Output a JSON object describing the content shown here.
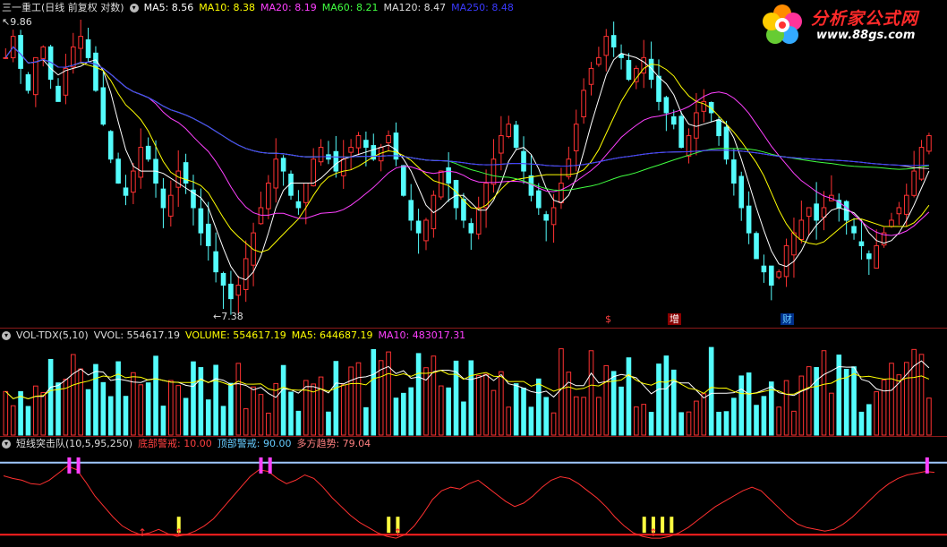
{
  "price_header": {
    "title": "三一重工(日线 前复权 对数)",
    "ma": [
      {
        "label": "MA5: 8.56",
        "color": "#ffffff"
      },
      {
        "label": "MA10: 8.38",
        "color": "#ffff00"
      },
      {
        "label": "MA20: 8.19",
        "color": "#ff40ff"
      },
      {
        "label": "MA60: 8.21",
        "color": "#40ff40"
      },
      {
        "label": "MA120: 8.47",
        "color": "#dddddd"
      },
      {
        "label": "MA250: 8.48",
        "color": "#3a3aff"
      }
    ]
  },
  "price_marks": {
    "high": "9.86",
    "low": "←7.38"
  },
  "event_labels": [
    {
      "text": "$",
      "color": "#ff4040"
    },
    {
      "text": "增",
      "color": "#ffffff",
      "bg": "#8b0000"
    },
    {
      "text": "财",
      "color": "#66ccff",
      "bg": "#00308b"
    }
  ],
  "logo": {
    "title": "分析家公式网",
    "url": "www.88gs.com"
  },
  "vol_header": {
    "title": "VOL-TDX(5,10)",
    "items": [
      {
        "label": "VVOL: 554617.19",
        "color": "#dddddd"
      },
      {
        "label": "VOLUME: 554617.19",
        "color": "#ffff00"
      },
      {
        "label": "MA5: 644687.19",
        "color": "#ffff00"
      },
      {
        "label": "MA10: 483017.31",
        "color": "#ff40ff"
      }
    ]
  },
  "ind_header": {
    "title": "短线突击队(10,5,95,250)",
    "items": [
      {
        "label": "底部警戒: 10.00",
        "color": "#ff4040"
      },
      {
        "label": "顶部警戒: 90.00",
        "color": "#66ccff"
      },
      {
        "label": "多方趋势: 79.04",
        "color": "#ff8080"
      }
    ]
  },
  "chart_data": [
    {
      "type": "candlestick",
      "title": "三一重工(日线 前复权 对数)",
      "ylim": [
        7.38,
        9.86
      ],
      "log_scale": true,
      "series": [
        {
          "name": "MA5",
          "values": [
            8.56
          ]
        },
        {
          "name": "MA10",
          "values": [
            8.38
          ]
        },
        {
          "name": "MA20",
          "values": [
            8.19
          ]
        },
        {
          "name": "MA60",
          "values": [
            8.21
          ]
        },
        {
          "name": "MA120",
          "values": [
            8.47
          ]
        },
        {
          "name": "MA250",
          "values": [
            8.48
          ]
        }
      ],
      "close_trend": [
        9.5,
        9.7,
        9.4,
        9.2,
        9.5,
        9.6,
        9.3,
        9.1,
        9.4,
        9.6,
        9.7,
        9.5,
        9.2,
        8.9,
        8.6,
        8.4,
        8.3,
        8.5,
        8.7,
        8.6,
        8.4,
        8.2,
        8.3,
        8.5,
        8.4,
        8.2,
        8.0,
        7.9,
        7.7,
        7.6,
        7.5,
        7.6,
        7.8,
        8.0,
        8.2,
        8.4,
        8.6,
        8.5,
        8.3,
        8.2,
        8.4,
        8.6,
        8.7,
        8.6,
        8.5,
        8.6,
        8.7,
        8.8,
        8.7,
        8.6,
        8.7,
        8.8,
        8.6,
        8.3,
        8.1,
        8.0,
        8.1,
        8.3,
        8.5,
        8.4,
        8.2,
        8.1,
        8.0,
        8.2,
        8.4,
        8.6,
        8.8,
        8.9,
        8.7,
        8.5,
        8.3,
        8.2,
        8.1,
        8.2,
        8.4,
        8.6,
        8.9,
        9.2,
        9.4,
        9.5,
        9.7,
        9.6,
        9.5,
        9.3,
        9.4,
        9.5,
        9.3,
        9.1,
        9.0,
        8.9,
        8.7,
        8.8,
        9.0,
        9.1,
        9.0,
        8.8,
        8.6,
        8.4,
        8.2,
        8.0,
        7.8,
        7.7,
        7.6,
        7.7,
        7.9,
        8.0,
        8.1,
        8.2,
        8.1,
        8.2,
        8.3,
        8.2,
        8.1,
        8.0,
        7.9,
        7.8,
        7.9,
        8.0,
        8.1,
        8.2,
        8.3,
        8.5,
        8.7,
        8.8
      ]
    },
    {
      "type": "bar",
      "title": "VOL-TDX(5,10)",
      "series": [
        {
          "name": "VOLUME",
          "values": [
            554617.19
          ]
        },
        {
          "name": "MA5",
          "values": [
            644687.19
          ]
        },
        {
          "name": "MA10",
          "values": [
            483017.31
          ]
        }
      ]
    },
    {
      "type": "line",
      "title": "短线突击队(10,5,95,250)",
      "ylim": [
        0,
        100
      ],
      "series": [
        {
          "name": "底部警戒",
          "values": [
            10.0
          ]
        },
        {
          "name": "顶部警戒",
          "values": [
            90.0
          ]
        },
        {
          "name": "多方趋势",
          "values": [
            79.04
          ]
        }
      ],
      "trend_shape": [
        75,
        72,
        70,
        66,
        65,
        70,
        78,
        86,
        82,
        68,
        52,
        40,
        28,
        18,
        12,
        8,
        10,
        14,
        9,
        6,
        8,
        12,
        18,
        26,
        38,
        50,
        62,
        74,
        82,
        80,
        72,
        66,
        70,
        76,
        72,
        62,
        50,
        40,
        30,
        22,
        16,
        10,
        6,
        4,
        8,
        18,
        32,
        48,
        58,
        62,
        60,
        66,
        70,
        62,
        54,
        46,
        40,
        44,
        52,
        62,
        70,
        74,
        72,
        66,
        58,
        50,
        40,
        28,
        18,
        10,
        6,
        4,
        4,
        6,
        10,
        16,
        24,
        32,
        40,
        46,
        52,
        58,
        62,
        58,
        48,
        38,
        28,
        20,
        16,
        14,
        12,
        14,
        20,
        28,
        38,
        48,
        58,
        66,
        72,
        76,
        78,
        80,
        79
      ]
    }
  ]
}
